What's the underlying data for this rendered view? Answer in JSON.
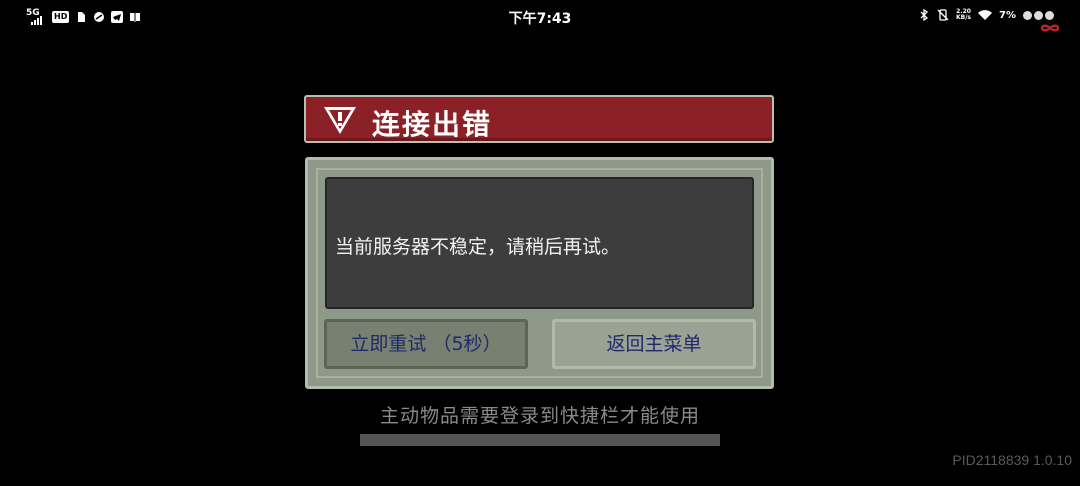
{
  "status_bar": {
    "signal_label": "5G",
    "hd_label": "HD",
    "time": "下午7:43",
    "net_speed_value": "2.20",
    "net_speed_unit": "KB/s",
    "battery": "7%"
  },
  "dialog": {
    "title": "连接出错",
    "message": "当前服务器不稳定，请稍后再试。",
    "retry_label": "立即重试 （5秒）",
    "menu_label": "返回主菜单"
  },
  "tip": "主动物品需要登录到快捷栏才能使用",
  "version": "PID2118839 1.0.10",
  "colors": {
    "title_bar": "#8b2127",
    "panel": "#8f998a",
    "message_box": "#3d3d3d",
    "button_text": "#1f2a6b"
  }
}
